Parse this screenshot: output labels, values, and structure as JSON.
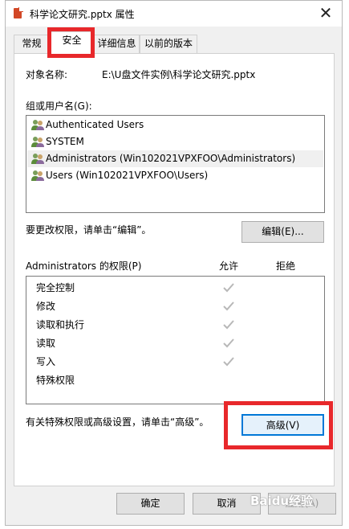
{
  "window": {
    "title": "科学论文研究.pptx 属性",
    "close_glyph": "✕"
  },
  "tabs": [
    {
      "label": "常规"
    },
    {
      "label": "安全"
    },
    {
      "label": "详细信息"
    },
    {
      "label": "以前的版本"
    }
  ],
  "object": {
    "label": "对象名称:",
    "value": "E:\\U盘文件实例\\科学论文研究.pptx"
  },
  "groups": {
    "label": "组或用户名(G):",
    "users": [
      {
        "name": "Authenticated Users",
        "icon": "users-icon"
      },
      {
        "name": "SYSTEM",
        "icon": "users-icon"
      },
      {
        "name": "Administrators (Win102021VPXFOO\\Administrators)",
        "icon": "users-icon",
        "selected": true
      },
      {
        "name": "Users (Win102021VPXFOO\\Users)",
        "icon": "users-icon"
      }
    ]
  },
  "edit": {
    "hint": "要更改权限，请单击“编辑”。",
    "button": "编辑(E)..."
  },
  "permissions": {
    "label": "Administrators 的权限(P)",
    "allow_header": "允许",
    "deny_header": "拒绝",
    "rows": [
      {
        "name": "完全控制",
        "allow": true
      },
      {
        "name": "修改",
        "allow": true
      },
      {
        "name": "读取和执行",
        "allow": true
      },
      {
        "name": "读取",
        "allow": true
      },
      {
        "name": "写入",
        "allow": true
      },
      {
        "name": "特殊权限",
        "allow": false
      }
    ]
  },
  "advanced": {
    "hint": "有关特殊权限或高级设置，请单击“高级”。",
    "button": "高级(V)"
  },
  "footer": {
    "ok": "确定",
    "cancel": "取消",
    "apply": "应用(A)"
  },
  "watermark": "Baidu经验",
  "colors": {
    "highlight": "#e8282b",
    "selected_row": "#f0f0f0",
    "check": "#b8b8b8"
  }
}
